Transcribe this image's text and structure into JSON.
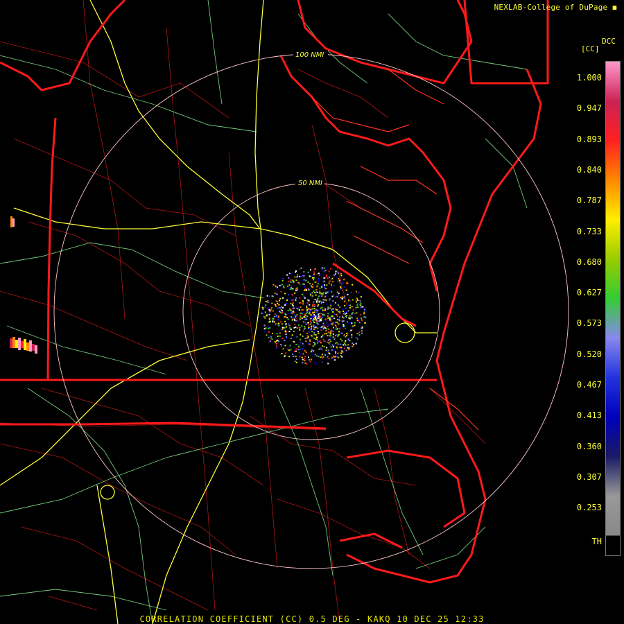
{
  "credit": "NEXLAB-College of DuPage",
  "footer": "CORRELATION COEFFICIENT (CC) 0.5 DEG - KAKQ 10 DEC 25 12:33",
  "legend": {
    "title_top": "DCC",
    "title_unit": "[CC]",
    "ticks": [
      "1.000",
      "0.947",
      "0.893",
      "0.840",
      "0.787",
      "0.733",
      "0.680",
      "0.627",
      "0.573",
      "0.520",
      "0.467",
      "0.413",
      "0.360",
      "0.307",
      "0.253",
      "TH"
    ]
  },
  "rings": {
    "inner_label": "50 NMI",
    "outer_label": "100 NMI"
  },
  "colors": {
    "background": "#000000",
    "state_border": "#ff1a1a",
    "county_lines": "#cc1a1a",
    "highways": "#7fe08a",
    "interstates": "#ffff33",
    "range_rings": "#ffc8c8",
    "text": "#ffff33"
  },
  "colorbar_stops": [
    "#ff99cc",
    "#cc2255",
    "#ff2020",
    "#ff8800",
    "#ffee00",
    "#99cc00",
    "#33cc33",
    "#8888ee",
    "#2233dd",
    "#0000bb",
    "#1a1a66",
    "#999999",
    "#888888"
  ]
}
